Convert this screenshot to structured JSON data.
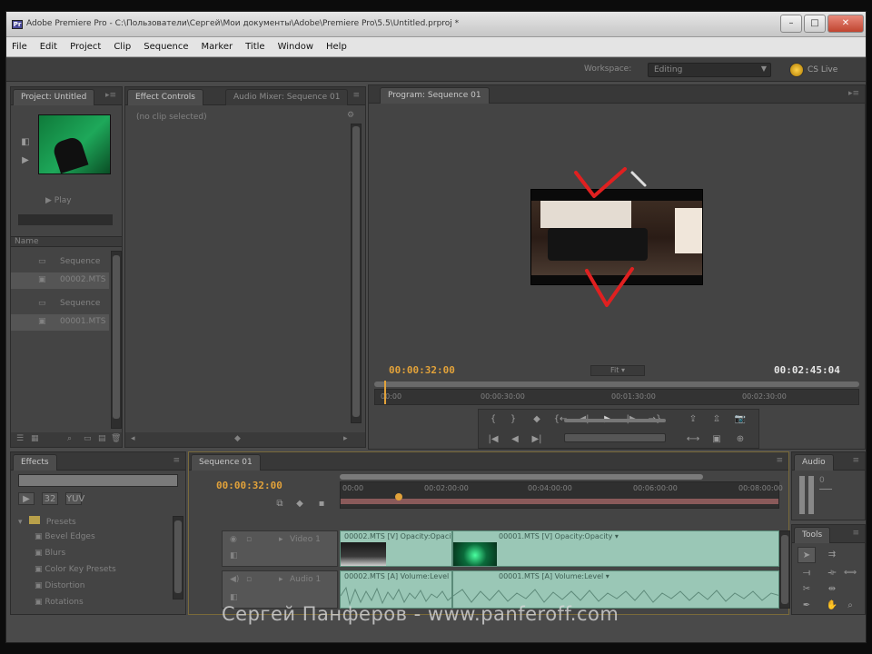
{
  "window": {
    "title": "Adobe Premiere Pro - C:\\Пользователи\\Сергей\\Мои документы\\Adobe\\Premiere Pro\\5.5\\Untitled.prproj *",
    "minimize": "–",
    "maximize": "□",
    "close": "✕"
  },
  "menu": [
    "File",
    "Edit",
    "Project",
    "Clip",
    "Sequence",
    "Marker",
    "Title",
    "Window",
    "Help"
  ],
  "workspace": {
    "label": "Workspace:",
    "value": "Editing",
    "cs_live": "CS Live"
  },
  "project_panel": {
    "tab": "Project: Untitled",
    "thumb_info": "▶ Play",
    "search_placeholder": "",
    "name_header": "Name",
    "items": [
      {
        "kind": "sequence",
        "label": "Sequence"
      },
      {
        "kind": "clip",
        "label": "00002.MTS"
      },
      {
        "kind": "sequence",
        "label": "Sequence"
      },
      {
        "kind": "clip",
        "label": "00001.MTS"
      }
    ]
  },
  "effect_controls": {
    "tab_active": "Effect Controls",
    "tab_inactive": "Audio Mixer: Sequence 01",
    "placeholder": "(no clip selected)"
  },
  "program_monitor": {
    "tab": "Program: Sequence 01",
    "current_tc": "00:00:32:00",
    "duration_tc": "00:02:45:04",
    "zoom": "Fit",
    "ruler": [
      "00:00",
      "00:00:30:00",
      "00:01:30:00",
      "00:02:30:00"
    ]
  },
  "effects_panel": {
    "tab": "Effects",
    "folder": "Presets",
    "items": [
      "Bevel Edges",
      "Blurs",
      "Color Key Presets",
      "Distortion",
      "Rotations"
    ]
  },
  "timeline": {
    "tab": "Sequence 01",
    "current_tc": "00:00:32:00",
    "ruler": [
      "00:00",
      "00:02:00:00",
      "00:04:00:00",
      "00:06:00:00",
      "00:08:00:00"
    ],
    "video_track": "Video 1",
    "audio_track": "Audio 1",
    "video_clip_label": "00002.MTS [V] Opacity:Opacity ▾",
    "video_clip_label2": "00001.MTS [V] Opacity:Opacity ▾",
    "audio_clip_label": "00002.MTS [A] Volume:Level ▾",
    "audio_clip_label2": "00001.MTS [A] Volume:Level ▾"
  },
  "audio_meters": {
    "tab": "Audio",
    "db": "0"
  },
  "tools_panel": {
    "tab": "Tools"
  },
  "watermark": "Сергей Панферов - www.panferoff.com",
  "colors": {
    "accent_timecode": "#e2a23a",
    "clip_fill": "#9ac7b6",
    "annotation_red": "#e02020",
    "playhead_red": "#d03030"
  }
}
